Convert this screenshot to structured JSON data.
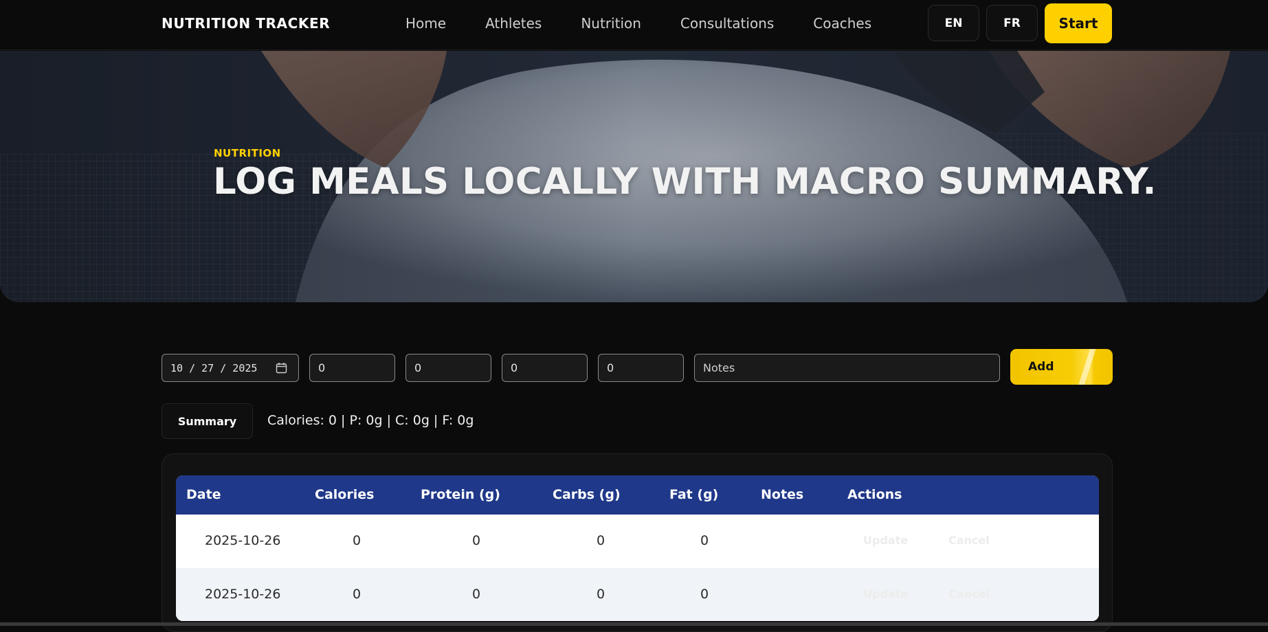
{
  "navbar": {
    "brand": "NUTRITION TRACKER",
    "links": [
      "Home",
      "Athletes",
      "Nutrition",
      "Consultations",
      "Coaches"
    ],
    "lang_en": "EN",
    "lang_fr": "FR",
    "start_label": "Start",
    "accent_color": "#ffd000"
  },
  "hero": {
    "eyebrow": "NUTRITION",
    "title": "LOG MEALS LOCALLY WITH MACRO SUMMARY."
  },
  "form": {
    "date_value": "10 / 27 / 2025",
    "calories_value": "0",
    "protein_value": "0",
    "carbs_value": "0",
    "fat_value": "0",
    "notes_placeholder": "Notes",
    "add_label": "Add"
  },
  "summary": {
    "button_label": "Summary",
    "text": "Calories: 0 | P: 0g | C: 0g | F: 0g"
  },
  "table": {
    "header_color": "#1f3889",
    "headers": [
      "Date",
      "Calories",
      "Protein (g)",
      "Carbs (g)",
      "Fat (g)",
      "Notes",
      "Actions"
    ],
    "rows": [
      {
        "date": "2025-10-26",
        "calories": "0",
        "protein": "0",
        "carbs": "0",
        "fat": "0",
        "notes": "",
        "update": "Update",
        "cancel": "Cancel"
      },
      {
        "date": "2025-10-26",
        "calories": "0",
        "protein": "0",
        "carbs": "0",
        "fat": "0",
        "notes": "",
        "update": "Update",
        "cancel": "Cancel"
      }
    ]
  }
}
